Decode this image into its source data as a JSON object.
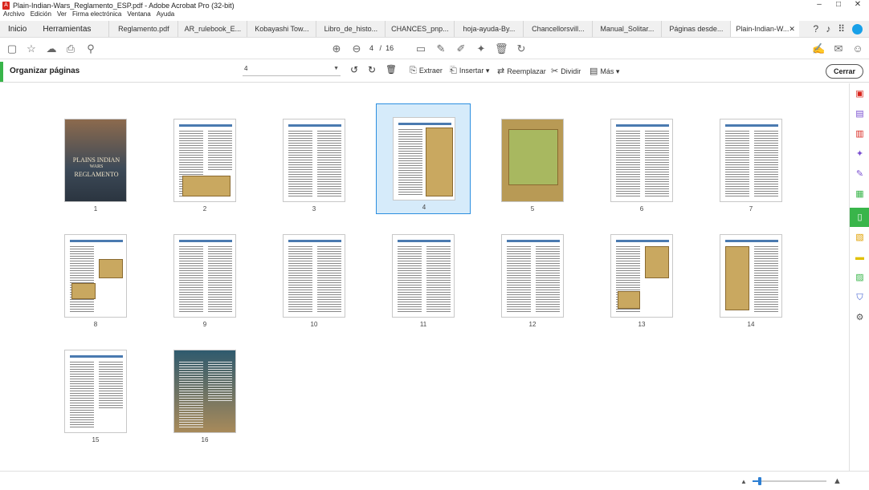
{
  "window": {
    "title": "Plain-Indian-Wars_Reglamento_ESP.pdf - Adobe Acrobat Pro (32-bit)",
    "minimize": "–",
    "maximize": "□",
    "close": "✕"
  },
  "menu": [
    "Archivo",
    "Edición",
    "Ver",
    "Firma electrónica",
    "Ventana",
    "Ayuda"
  ],
  "tabs": {
    "home": "Inicio",
    "tools": "Herramientas",
    "docs": [
      "Reglamento.pdf",
      "AR_rulebook_E...",
      "Kobayashi Tow...",
      "Libro_de_histo...",
      "CHANCES_pnp...",
      "hoja-ayuda-By...",
      "Chancellorsvill...",
      "Manual_Solitar...",
      "Páginas desde..."
    ],
    "active": "Plain-Indian-W...",
    "active_close": "✕"
  },
  "toolbar": {
    "current_page": "4",
    "separator": "/",
    "total_pages": "16"
  },
  "organize": {
    "title": "Organizar páginas",
    "page_select": "4",
    "extract": "Extraer",
    "insert": "Insertar",
    "replace": "Reemplazar",
    "split": "Dividir",
    "more": "Más",
    "close": "Cerrar"
  },
  "cover": {
    "line1": "PLAINS INDIAN",
    "line2": "WARS",
    "line3": "REGLAMENTO"
  },
  "pages": [
    "1",
    "2",
    "3",
    "4",
    "5",
    "6",
    "7",
    "8",
    "9",
    "10",
    "11",
    "12",
    "13",
    "14",
    "15",
    "16"
  ],
  "selected_page": "4",
  "zoom": {
    "level_fraction": 0.1
  },
  "colors": {
    "accent": "#39b54a",
    "selection": "#2d8fe0"
  }
}
